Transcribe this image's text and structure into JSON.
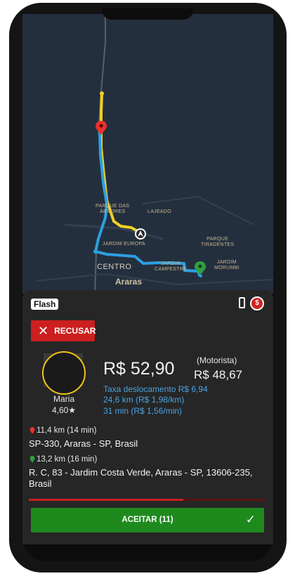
{
  "map": {
    "labels": {
      "parque_das_arvores": "PARQUE DAS\nÁRVORES",
      "lajeado": "LAJEADO",
      "parque_tiradentes": "PARQUE\nTIRADENTES",
      "jardim_europa": "JARDIM EUROPA",
      "jardim_morumbi": "JARDIM\nMORUMBI",
      "centro": "CENTRO",
      "jardim_campestre": "JARDIM\nCAMPESTRE",
      "araras": "Araras"
    },
    "colors": {
      "route_to_pickup": "#f2d024",
      "route_trip": "#2d9fe0",
      "pickup_pin": "#e8322b",
      "dest_pin": "#2ea043",
      "background": "#242f3e"
    }
  },
  "ride": {
    "category_badge": "Flash",
    "payment_icons": [
      "smartphone-icon",
      "no-cash-icon"
    ],
    "refuse_label": "RECUSAR",
    "passenger": {
      "name": "Maria",
      "rating": "4,60★"
    },
    "price": "R$ 52,90",
    "driver_label": "(Motorista)",
    "driver_value": "R$ 48,67",
    "fee": "Taxa deslocamento R$ 6,94",
    "distance": "24,6 km (R$ 1,98/km)",
    "duration": "31 min (R$ 1,56/min)",
    "pickup": {
      "meta": "11,4 km (14 min)",
      "address": "SP-330, Araras - SP, Brasil"
    },
    "destination": {
      "meta": "13,2 km (16 min)",
      "address": "R. C, 83 - Jardim Costa Verde, Araras - SP, 13606-235, Brasil"
    },
    "timer_progress": 0.65,
    "accept_label": "ACEITAR (11)",
    "accept_icon": "check-icon"
  }
}
